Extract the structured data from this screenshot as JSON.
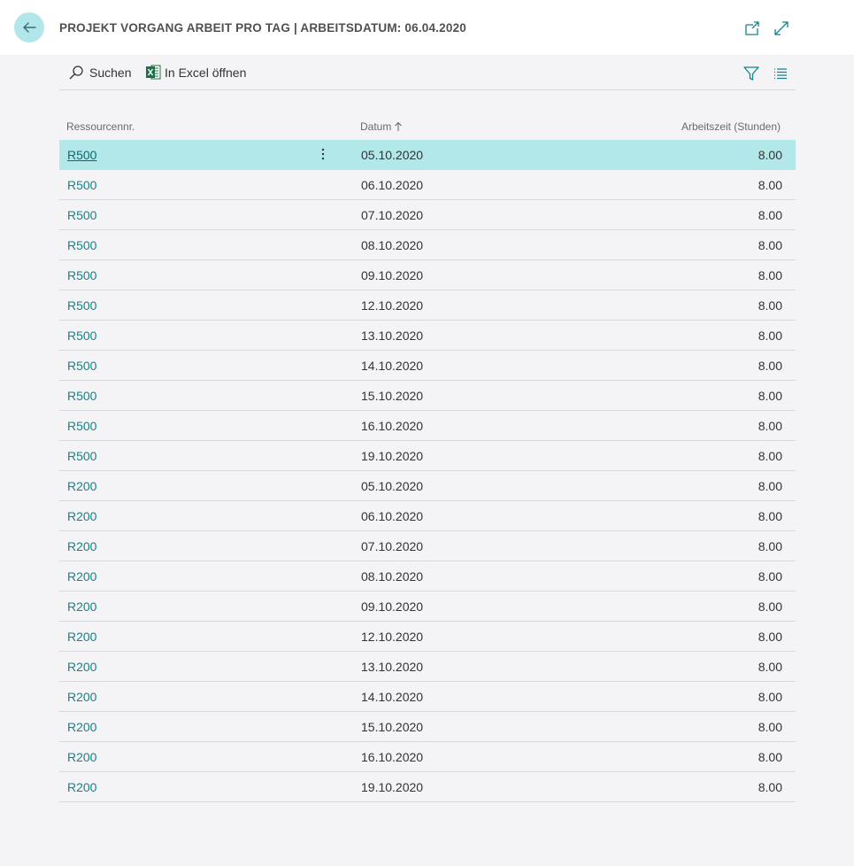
{
  "header": {
    "title": "PROJEKT VORGANG ARBEIT PRO TAG | ARBEITSDATUM: 06.04.2020"
  },
  "toolbar": {
    "search_label": "Suchen",
    "excel_label": "In Excel öffnen"
  },
  "columns": {
    "resource": "Ressourcennr.",
    "date": "Datum",
    "hours": "Arbeitszeit (Stunden)"
  },
  "rows": [
    {
      "resource": "R500",
      "date": "05.10.2020",
      "hours": "8.00"
    },
    {
      "resource": "R500",
      "date": "06.10.2020",
      "hours": "8.00"
    },
    {
      "resource": "R500",
      "date": "07.10.2020",
      "hours": "8.00"
    },
    {
      "resource": "R500",
      "date": "08.10.2020",
      "hours": "8.00"
    },
    {
      "resource": "R500",
      "date": "09.10.2020",
      "hours": "8.00"
    },
    {
      "resource": "R500",
      "date": "12.10.2020",
      "hours": "8.00"
    },
    {
      "resource": "R500",
      "date": "13.10.2020",
      "hours": "8.00"
    },
    {
      "resource": "R500",
      "date": "14.10.2020",
      "hours": "8.00"
    },
    {
      "resource": "R500",
      "date": "15.10.2020",
      "hours": "8.00"
    },
    {
      "resource": "R500",
      "date": "16.10.2020",
      "hours": "8.00"
    },
    {
      "resource": "R500",
      "date": "19.10.2020",
      "hours": "8.00"
    },
    {
      "resource": "R200",
      "date": "05.10.2020",
      "hours": "8.00"
    },
    {
      "resource": "R200",
      "date": "06.10.2020",
      "hours": "8.00"
    },
    {
      "resource": "R200",
      "date": "07.10.2020",
      "hours": "8.00"
    },
    {
      "resource": "R200",
      "date": "08.10.2020",
      "hours": "8.00"
    },
    {
      "resource": "R200",
      "date": "09.10.2020",
      "hours": "8.00"
    },
    {
      "resource": "R200",
      "date": "12.10.2020",
      "hours": "8.00"
    },
    {
      "resource": "R200",
      "date": "13.10.2020",
      "hours": "8.00"
    },
    {
      "resource": "R200",
      "date": "14.10.2020",
      "hours": "8.00"
    },
    {
      "resource": "R200",
      "date": "15.10.2020",
      "hours": "8.00"
    },
    {
      "resource": "R200",
      "date": "16.10.2020",
      "hours": "8.00"
    },
    {
      "resource": "R200",
      "date": "19.10.2020",
      "hours": "8.00"
    }
  ],
  "selected_row_index": 0,
  "colors": {
    "accent": "#138489",
    "selected_row": "#b3e8ea",
    "back_button": "#b1e7ea",
    "excel_green": "#1d7044"
  },
  "icons": {
    "back": "arrow-left-icon",
    "pop_out": "pop-out-icon",
    "expand": "expand-icon",
    "search": "search-icon",
    "excel": "excel-icon",
    "filter": "filter-icon",
    "list_view": "list-view-icon",
    "sort": "sort-ascending-icon",
    "row_menu": "more-vertical-icon"
  }
}
